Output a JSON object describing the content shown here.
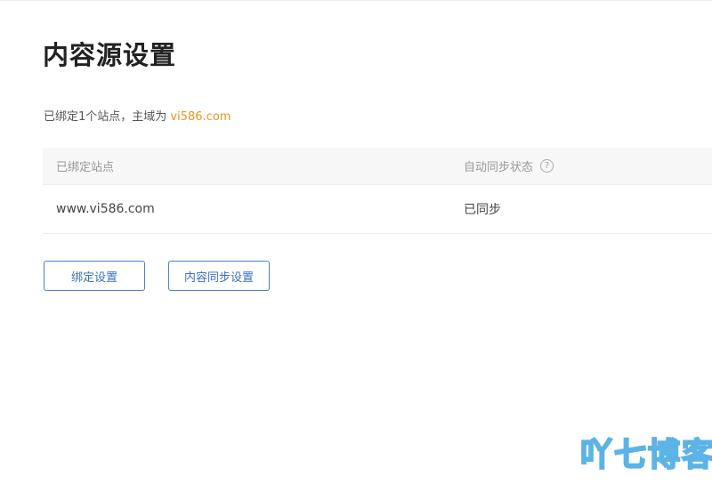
{
  "page": {
    "title": "内容源设置"
  },
  "summary": {
    "prefix": "已绑定1个站点，主域为",
    "domain": "vi586.com"
  },
  "table": {
    "headers": {
      "site": "已绑定站点",
      "sync_status": "自动同步状态"
    },
    "help_icon": "question-circle-icon",
    "rows": [
      {
        "site": "www.vi586.com",
        "sync_status": "已同步"
      }
    ]
  },
  "actions": {
    "bind_settings": "绑定设置",
    "content_sync_settings": "内容同步设置"
  },
  "watermark": {
    "text": "吖七博客"
  },
  "colors": {
    "accent": "#3a6fc4",
    "domain_highlight": "#e8961f",
    "header_bg": "#f7f7f7",
    "watermark": "#5cb3e6"
  }
}
